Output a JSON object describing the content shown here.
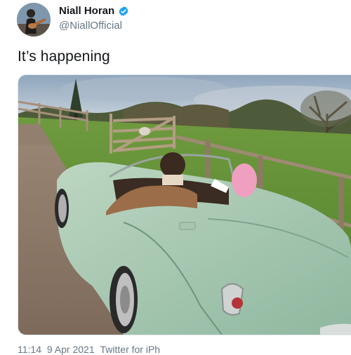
{
  "author": {
    "display_name": "Niall Horan",
    "handle": "@NiallOfficial",
    "verified": true,
    "verified_icon": "verified-badge-icon",
    "verified_color": "#1da1f2"
  },
  "tweet": {
    "text": "It’s happening"
  },
  "media": {
    "type": "photo",
    "icon": "photo"
  },
  "meta": {
    "time": "11:14 ",
    "date": "9 Apr 2021 ",
    "source": "Twitter for iPh"
  }
}
